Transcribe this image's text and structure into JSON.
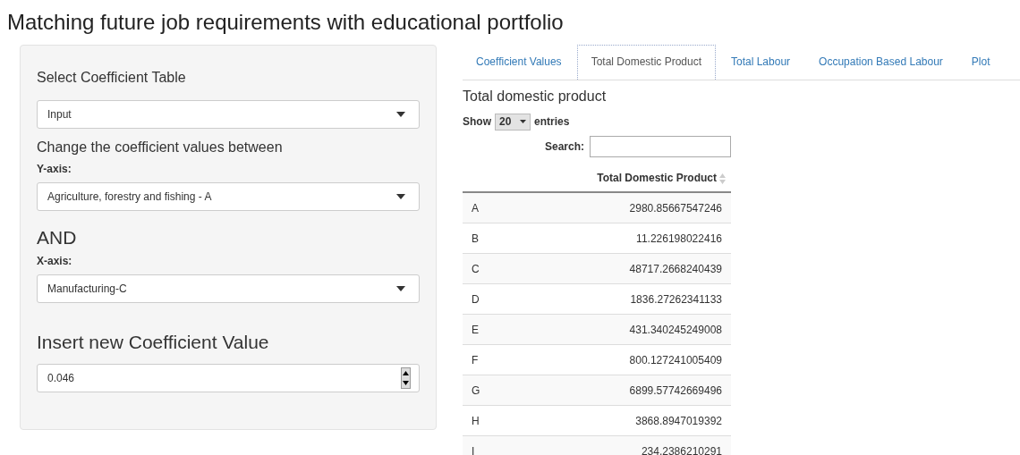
{
  "title": "Matching future job requirements with educational portfolio",
  "sidebar": {
    "table_label": "Select Coefficient Table",
    "table_select": "Input",
    "between_label": "Change the coefficient values between",
    "y_label": "Y-axis:",
    "y_select": "Agriculture, forestry and fishing - A",
    "and_label": "AND",
    "x_label": "X-axis:",
    "x_select": "Manufacturing-C",
    "insert_label": "Insert new Coefficient Value",
    "value": "0.046"
  },
  "tabs": [
    {
      "label": "Coefficient Values",
      "selected": false
    },
    {
      "label": "Total Domestic Product",
      "selected": true
    },
    {
      "label": "Total Labour",
      "selected": false
    },
    {
      "label": "Occupation Based Labour",
      "selected": false
    },
    {
      "label": "Plot",
      "selected": false
    }
  ],
  "panel": {
    "heading": "Total domestic product",
    "show_label": "Show",
    "page_size": "20",
    "entries_label": "entries",
    "search_label": "Search:"
  },
  "table": {
    "columns": [
      "",
      "Total Domestic Product"
    ],
    "rows": [
      [
        "A",
        "2980.85667547246"
      ],
      [
        "B",
        "11.226198022416"
      ],
      [
        "C",
        "48717.2668240439"
      ],
      [
        "D",
        "1836.27262341133"
      ],
      [
        "E",
        "431.340245249008"
      ],
      [
        "F",
        "800.127241005409"
      ],
      [
        "G",
        "6899.57742669496"
      ],
      [
        "H",
        "3868.8947019392"
      ],
      [
        "I",
        "234.2386210291"
      ]
    ]
  }
}
